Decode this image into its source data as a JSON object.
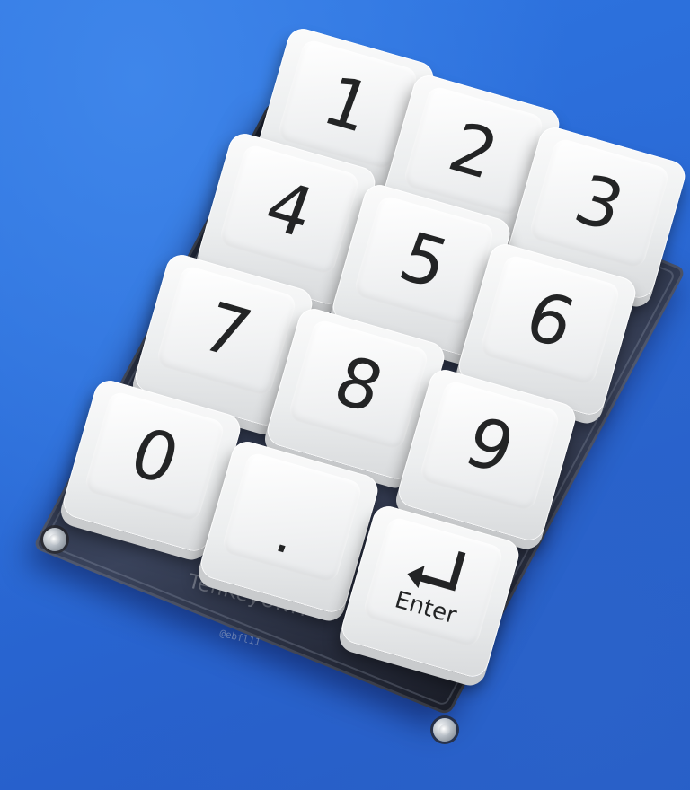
{
  "keypad": {
    "brand_text": "TenKeyUNIT",
    "author_text": "@ebfl11",
    "keys": [
      {
        "label": "1"
      },
      {
        "label": "2"
      },
      {
        "label": "3"
      },
      {
        "label": "4"
      },
      {
        "label": "5"
      },
      {
        "label": "6"
      },
      {
        "label": "7"
      },
      {
        "label": "8"
      },
      {
        "label": "9"
      },
      {
        "label": "0"
      },
      {
        "label": "."
      },
      {
        "label": "Enter",
        "icon": "enter-arrow-icon"
      }
    ]
  },
  "colors": {
    "background": "#2a6ad6",
    "keycap": "#eceeef",
    "legend": "#232425",
    "board": "#1e1e24"
  }
}
